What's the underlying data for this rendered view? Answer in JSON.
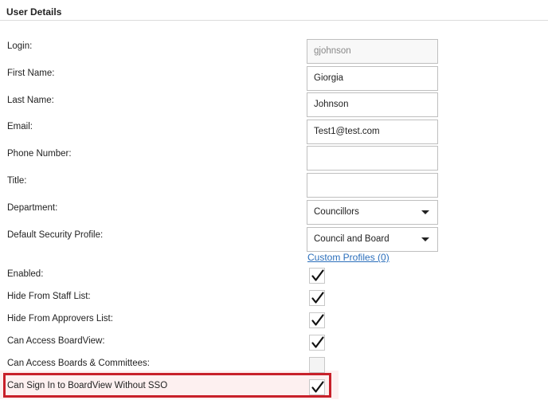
{
  "panel": {
    "title": "User Details"
  },
  "fields": {
    "login": {
      "label": "Login:",
      "value": "gjohnson"
    },
    "first_name": {
      "label": "First Name:",
      "value": "Giorgia"
    },
    "last_name": {
      "label": "Last Name:",
      "value": "Johnson"
    },
    "email": {
      "label": "Email:",
      "value": "Test1@test.com"
    },
    "phone": {
      "label": "Phone Number:",
      "value": ""
    },
    "title": {
      "label": "Title:",
      "value": ""
    },
    "department": {
      "label": "Department:",
      "value": "Councillors"
    },
    "security_profile": {
      "label": "Default Security Profile:",
      "value": "Council and Board"
    }
  },
  "custom_profiles_link": "Custom Profiles (0)",
  "checkboxes": {
    "enabled": {
      "label": "Enabled:",
      "checked": true
    },
    "hide_staff": {
      "label": "Hide From Staff List:",
      "checked": true
    },
    "hide_approvers": {
      "label": "Hide From Approvers List:",
      "checked": true
    },
    "access_boardview": {
      "label": "Can Access BoardView:",
      "checked": true
    },
    "access_boards": {
      "label": "Can Access Boards & Committees:",
      "checked": false
    },
    "sign_in_without_sso": {
      "label": "Can Sign In to BoardView Without SSO",
      "checked": true
    }
  },
  "colors": {
    "highlight": "#c8202a",
    "link": "#2a6ebb"
  },
  "icons": {
    "check": "checkmark-icon",
    "dropdown": "chevron-down-icon"
  }
}
